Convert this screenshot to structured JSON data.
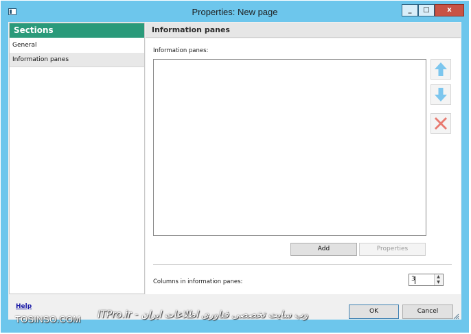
{
  "window": {
    "title": "Properties: New page",
    "minimize_label": "_",
    "maximize_label": "□",
    "close_label": "x"
  },
  "sidebar": {
    "header": "Sections",
    "items": [
      {
        "label": "General"
      },
      {
        "label": "Information panes"
      }
    ]
  },
  "main": {
    "header": "Information panes",
    "panes_label": "Information panes:",
    "add_label": "Add",
    "properties_label": "Properties",
    "columns_label": "Columns in information panes:",
    "columns_value": "3"
  },
  "footer": {
    "help_label": "Help",
    "ok_label": "OK",
    "cancel_label": "Cancel"
  },
  "watermark": {
    "left": "TOSINSO.COM",
    "right": "ITPro.ir - وب سایت تخصصی فناوری اطلاعات ایران"
  },
  "colors": {
    "titlebar": "#6dc6ec",
    "sections_header": "#2a9a7a",
    "close_button": "#c85345",
    "arrow_icon": "#7cc6ee",
    "remove_icon": "#e87a70"
  },
  "icons": {
    "move_up": "arrow-up-icon",
    "move_down": "arrow-down-icon",
    "remove": "x-mark-icon"
  }
}
